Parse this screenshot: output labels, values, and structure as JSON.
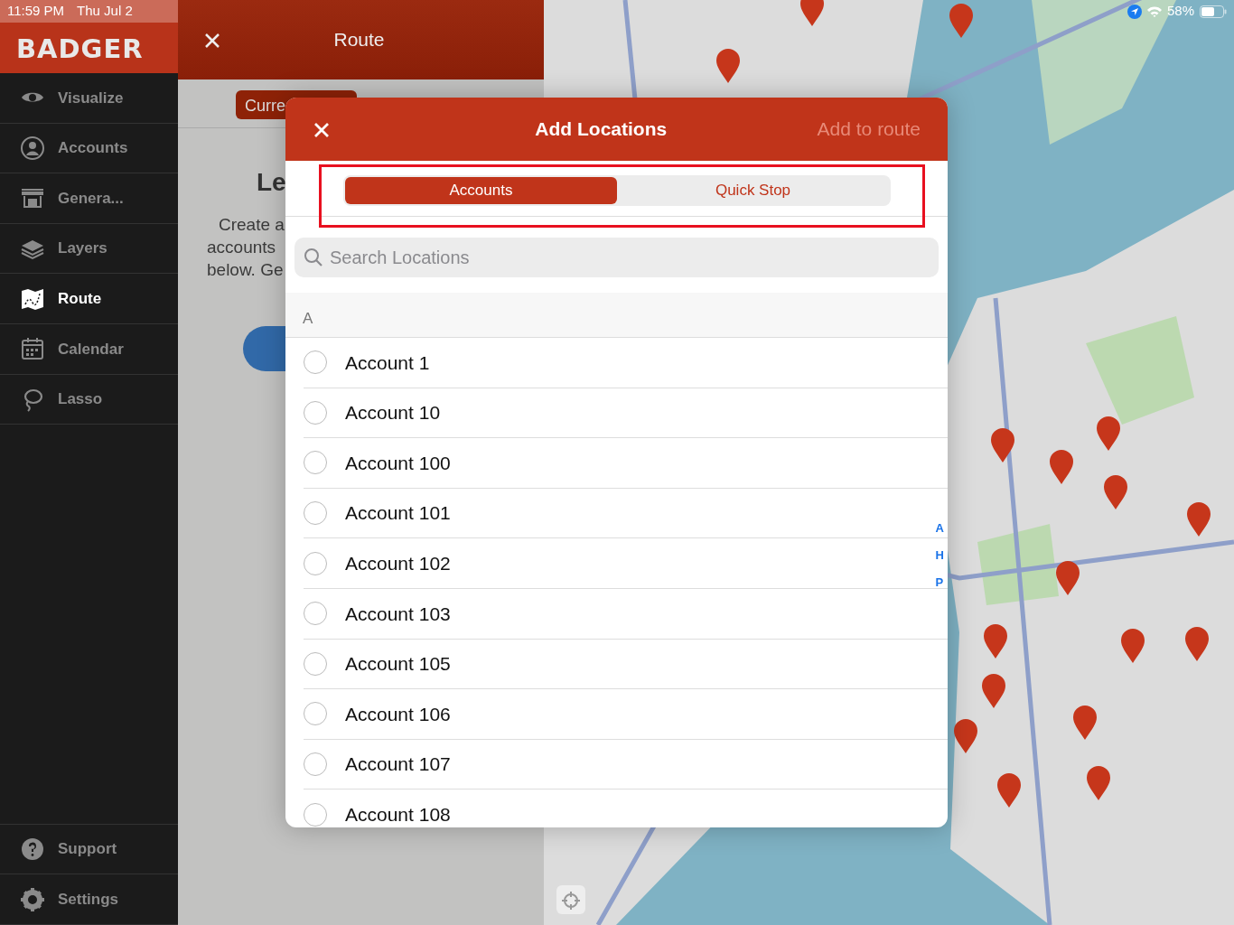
{
  "status_bar": {
    "time": "11:59 PM",
    "date": "Thu Jul 2",
    "battery": "58%"
  },
  "sidebar": {
    "logo": "BADGER",
    "items": [
      {
        "label": "Visualize",
        "selected": false
      },
      {
        "label": "Accounts",
        "selected": false
      },
      {
        "label": "Genera...",
        "selected": false
      },
      {
        "label": "Layers",
        "selected": false
      },
      {
        "label": "Route",
        "selected": true
      },
      {
        "label": "Calendar",
        "selected": false
      },
      {
        "label": "Lasso",
        "selected": false
      }
    ],
    "footer_items": [
      {
        "label": "Support"
      },
      {
        "label": "Settings"
      }
    ]
  },
  "route_panel": {
    "title": "Route",
    "tab": "Curre",
    "heading": "Le",
    "text_lines": [
      "Create a",
      "accounts",
      "below. Ge"
    ]
  },
  "modal": {
    "title": "Add Locations",
    "action": {
      "label": "Add to route",
      "disabled": true
    },
    "segments": [
      {
        "label": "Accounts",
        "selected": true
      },
      {
        "label": "Quick Stop",
        "selected": false
      }
    ],
    "search": {
      "placeholder": "Search Locations"
    },
    "section": "A",
    "rows": [
      {
        "label": "Account 1",
        "checked": false
      },
      {
        "label": "Account 10",
        "checked": false
      },
      {
        "label": "Account 100",
        "checked": false
      },
      {
        "label": "Account 101",
        "checked": false
      },
      {
        "label": "Account 102",
        "checked": false
      },
      {
        "label": "Account 103",
        "checked": false
      },
      {
        "label": "Account 105",
        "checked": false
      },
      {
        "label": "Account 106",
        "checked": false
      },
      {
        "label": "Account 107",
        "checked": false
      },
      {
        "label": "Account 108",
        "checked": false
      }
    ],
    "index_letters": [
      "A",
      "H",
      "P"
    ]
  }
}
